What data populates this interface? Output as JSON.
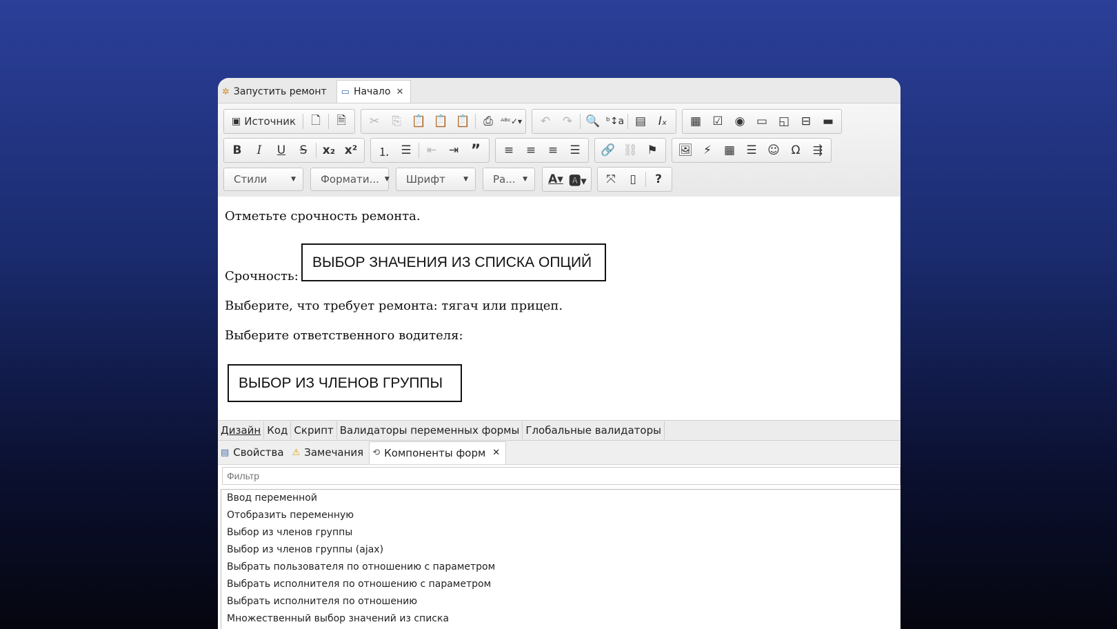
{
  "editor_tabs": [
    {
      "label": "Запустить ремонт",
      "icon": "workflow-icon"
    },
    {
      "label": "Начало",
      "icon": "form-window-icon",
      "active": true
    }
  ],
  "toolbar": {
    "source_label": "Источник",
    "styles_label": "Стили",
    "format_label": "Формати...",
    "font_label": "Шрифт",
    "size_label": "Ра..."
  },
  "content": {
    "line1": "Отметьте срочность ремонта.",
    "urgency_label": "Срочность:",
    "urgency_widget": "ВЫБОР ЗНАЧЕНИЯ ИЗ СПИСКА ОПЦИЙ",
    "line3": "Выберите, что требует ремонта: тягач или прицеп.",
    "line4": "Выберите ответственного водителя:",
    "driver_widget": "ВЫБОР ИЗ ЧЛЕНОВ ГРУППЫ"
  },
  "mode_tabs": [
    "Дизайн",
    "Код",
    "Скрипт",
    "Валидаторы переменных формы",
    "Глобальные валидаторы"
  ],
  "panel_tabs": [
    {
      "label": "Свойства",
      "icon": "properties-icon"
    },
    {
      "label": "Замечания",
      "icon": "warning-icon"
    },
    {
      "label": "Компоненты форм",
      "icon": "components-icon",
      "active": true
    }
  ],
  "filter_placeholder": "Фильтр",
  "components": [
    "Ввод переменной",
    "Отобразить переменную",
    "Выбор из членов группы",
    "Выбор из членов группы (ajax)",
    "Выбрать пользователя по отношению с параметром",
    "Выбрать исполнителя по отношению с параметром",
    "Выбрать исполнителя по отношению",
    "Множественный выбор значений из списка"
  ]
}
